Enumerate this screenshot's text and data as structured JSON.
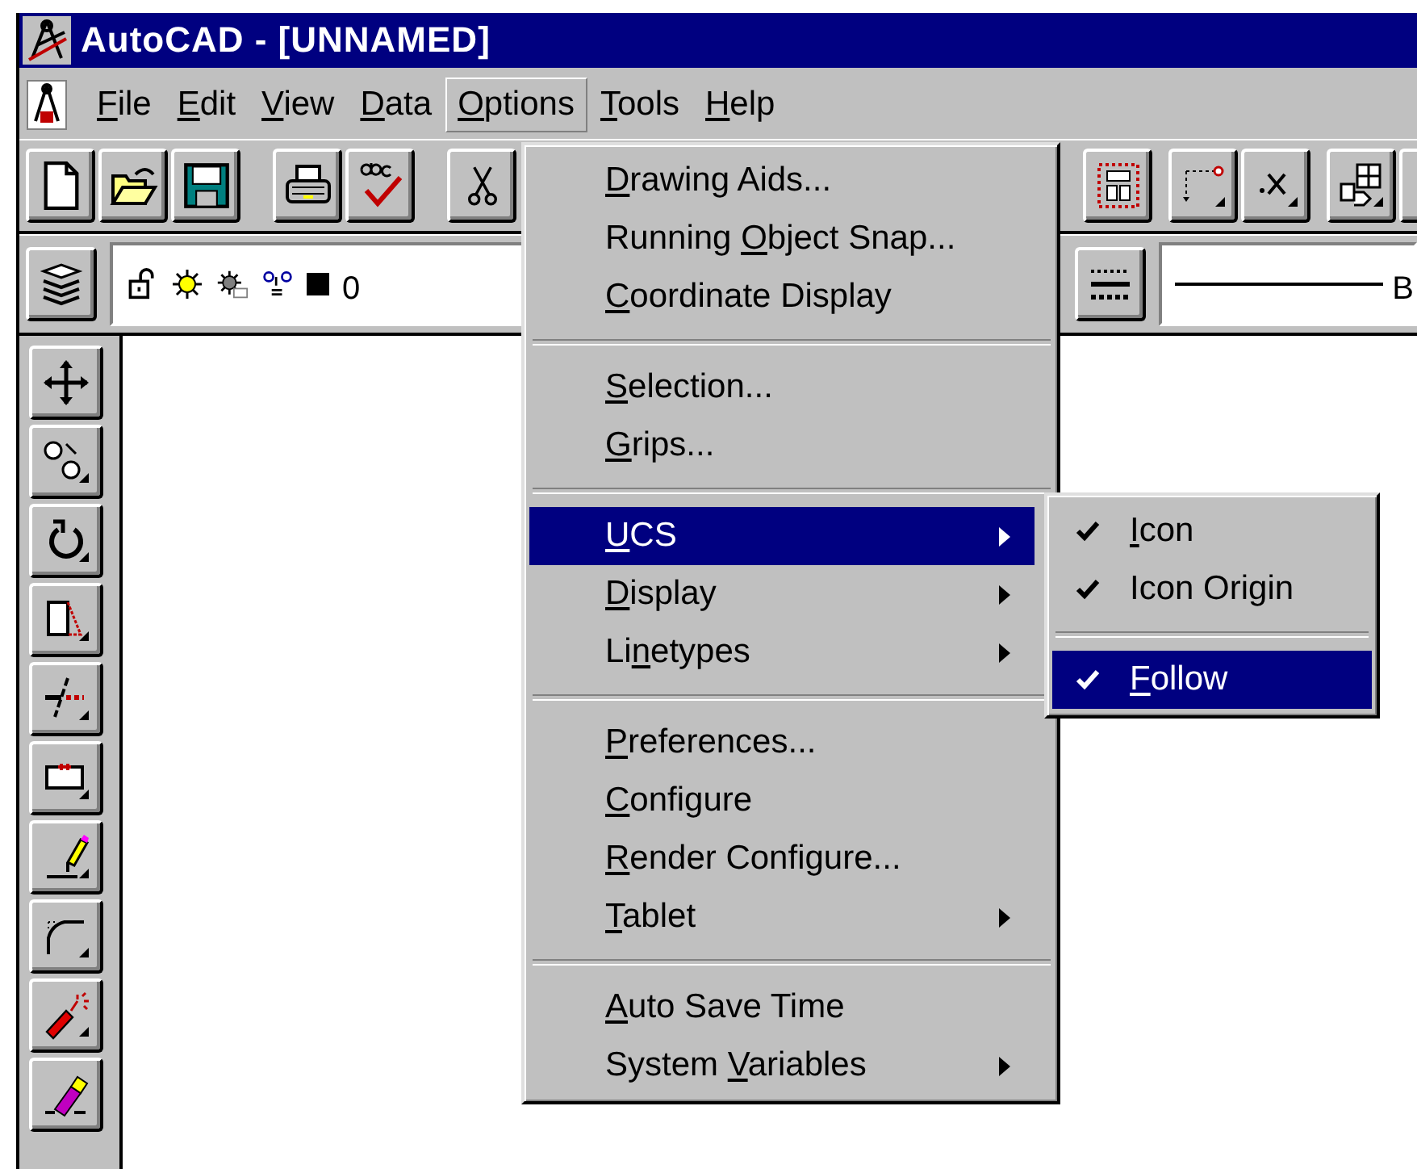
{
  "window": {
    "title": "AutoCAD - [UNNAMED]"
  },
  "menu_bar": [
    {
      "key": "F",
      "post": "ile",
      "selected": false
    },
    {
      "key": "E",
      "post": "dit",
      "selected": false
    },
    {
      "key": "V",
      "post": "iew",
      "selected": false
    },
    {
      "key": "D",
      "post": "ata",
      "selected": false
    },
    {
      "key": "O",
      "post": "ptions",
      "selected": true
    },
    {
      "key": "T",
      "post": "ools",
      "selected": false
    },
    {
      "key": "H",
      "post": "elp",
      "selected": false
    }
  ],
  "layer_field": {
    "value": "0"
  },
  "linetype_field": {
    "value": "B"
  },
  "options_menu": [
    {
      "kind": "item",
      "key": "D",
      "post": "rawing Aids...",
      "submenu": false,
      "selected": false
    },
    {
      "kind": "item",
      "pre": "Running ",
      "key": "O",
      "post": "bject Snap...",
      "submenu": false,
      "selected": false
    },
    {
      "kind": "item",
      "key": "C",
      "post": "oordinate Display",
      "submenu": false,
      "selected": false
    },
    {
      "kind": "separator"
    },
    {
      "kind": "item",
      "key": "S",
      "post": "election...",
      "submenu": false,
      "selected": false
    },
    {
      "kind": "item",
      "key": "G",
      "post": "rips...",
      "submenu": false,
      "selected": false
    },
    {
      "kind": "separator"
    },
    {
      "kind": "item",
      "key": "U",
      "post": "CS",
      "submenu": true,
      "selected": true
    },
    {
      "kind": "item",
      "key": "D",
      "post": "isplay",
      "submenu": true,
      "selected": false
    },
    {
      "kind": "item",
      "pre": "Li",
      "key": "n",
      "post": "etypes",
      "submenu": true,
      "selected": false
    },
    {
      "kind": "separator"
    },
    {
      "kind": "item",
      "key": "P",
      "post": "references...",
      "submenu": false,
      "selected": false
    },
    {
      "kind": "item",
      "key": "C",
      "post": "onfigure",
      "submenu": false,
      "selected": false
    },
    {
      "kind": "item",
      "key": "R",
      "post": "ender Configure...",
      "submenu": false,
      "selected": false
    },
    {
      "kind": "item",
      "key": "T",
      "post": "ablet",
      "submenu": true,
      "selected": false
    },
    {
      "kind": "separator"
    },
    {
      "kind": "item",
      "key": "A",
      "post": "uto Save Time",
      "submenu": false,
      "selected": false
    },
    {
      "kind": "item",
      "pre": "System ",
      "key": "V",
      "post": "ariables",
      "submenu": true,
      "selected": false
    }
  ],
  "ucs_submenu": [
    {
      "kind": "item",
      "key": "I",
      "post": "con",
      "checked": true,
      "selected": false
    },
    {
      "kind": "item",
      "pre": "Icon Origin",
      "checked": true,
      "selected": false
    },
    {
      "kind": "separator"
    },
    {
      "kind": "item",
      "key": "F",
      "post": "ollow",
      "checked": true,
      "selected": true
    }
  ]
}
